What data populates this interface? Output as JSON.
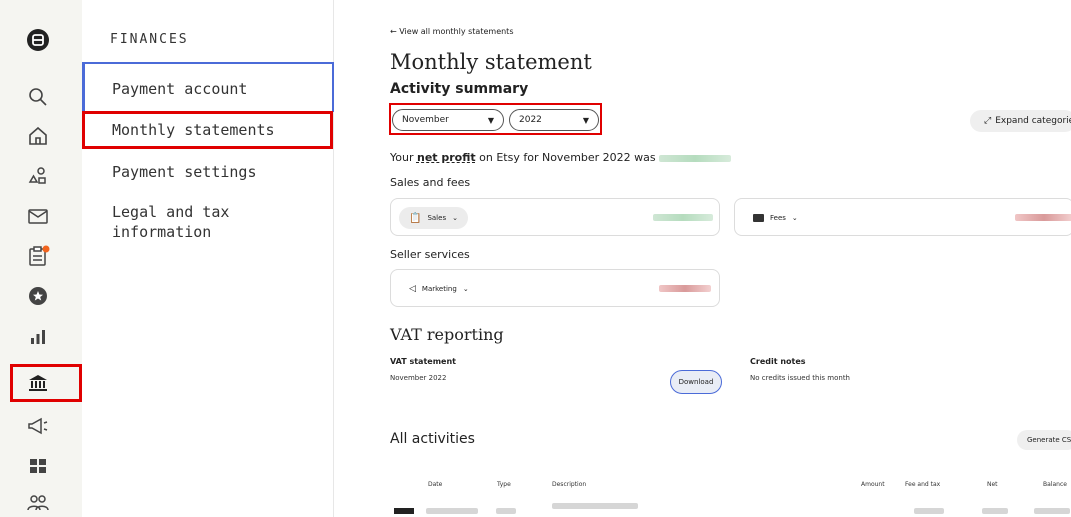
{
  "rail": {
    "items": [
      {
        "icon": "shop-manager-logo-icon"
      },
      {
        "icon": "search-icon"
      },
      {
        "icon": "home-icon"
      },
      {
        "icon": "listings-icon"
      },
      {
        "icon": "messages-icon"
      },
      {
        "icon": "orders-icon"
      },
      {
        "icon": "star-icon"
      },
      {
        "icon": "stats-icon"
      },
      {
        "icon": "finances-bank-icon"
      },
      {
        "icon": "marketing-megaphone-icon"
      },
      {
        "icon": "integrations-grid-icon"
      },
      {
        "icon": "community-icon"
      }
    ],
    "highlight_color": "#e00000",
    "notification_dot_color": "#f1641e"
  },
  "nav": {
    "heading": "FINANCES",
    "items": [
      {
        "label": "Payment account"
      },
      {
        "label": "Monthly statements"
      },
      {
        "label": "Payment settings"
      },
      {
        "label": "Legal and tax information"
      }
    ],
    "active_color": "#4b6bd8"
  },
  "main": {
    "back_link": "← View all monthly statements",
    "title": "Monthly statement",
    "activity_summary": "Activity summary",
    "month_select": "November",
    "year_select": "2022",
    "expand_label": "Expand categories",
    "profit_prefix": "Your",
    "profit_bold": "net profit",
    "profit_suffix": "on Etsy for November 2022 was",
    "sales_and_fees": "Sales and fees",
    "sales_chip": "Sales",
    "fees_chip": "Fees",
    "seller_services": "Seller services",
    "marketing_chip": "Marketing",
    "vat_title": "VAT reporting",
    "vat_statement_label": "VAT statement",
    "vat_statement_period": "November 2022",
    "download_label": "Download",
    "credit_notes_label": "Credit notes",
    "credit_notes_text": "No credits issued this month",
    "all_activities": "All activities",
    "generate_csv": "Generate CSV",
    "table_headers": [
      "Date",
      "Type",
      "Description",
      "Amount",
      "Fee and tax",
      "Net",
      "Balance"
    ]
  }
}
